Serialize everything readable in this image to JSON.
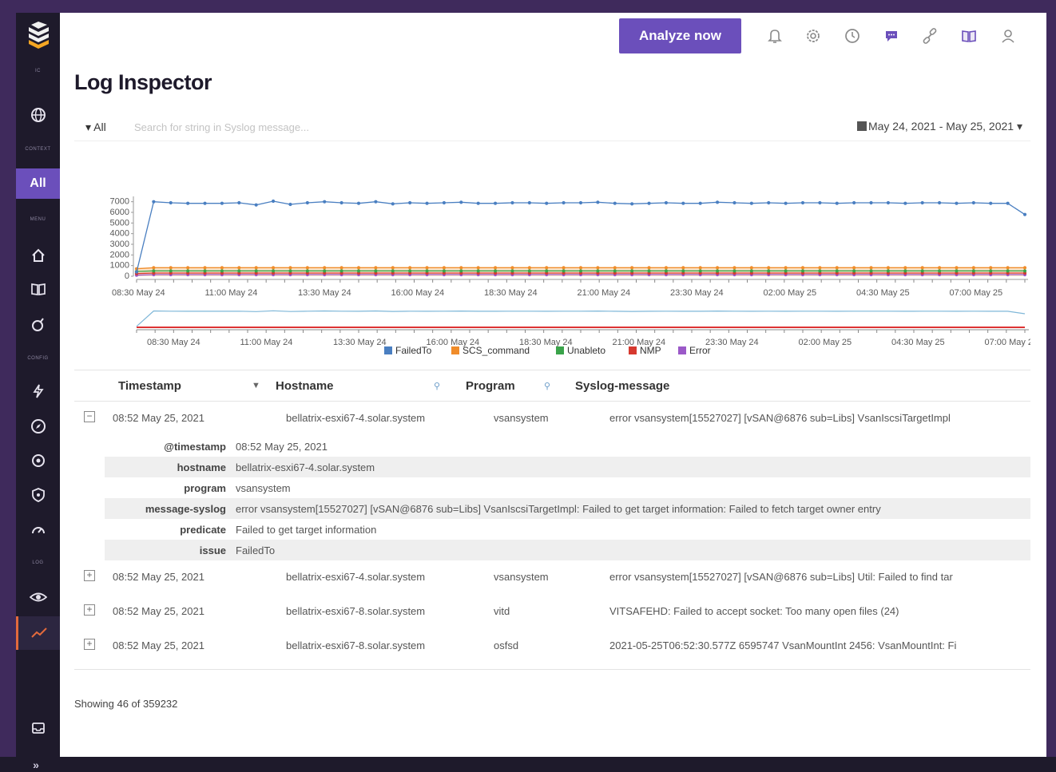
{
  "sidebar": {
    "sections": [
      "IC",
      "CONTEXT",
      "MENU",
      "CONFIG",
      "LOG"
    ],
    "all_label": "All"
  },
  "topbar": {
    "analyze_label": "Analyze now",
    "icons": [
      "bell-icon",
      "settings-icon",
      "help-icon",
      "chat-icon",
      "link-icon",
      "book-icon",
      "user-icon"
    ]
  },
  "page": {
    "title": "Log Inspector"
  },
  "filter": {
    "scope": "All",
    "search_placeholder": "Search for string in Syslog message...",
    "date_range": "May 24, 2021 - May 25, 2021"
  },
  "chart_data": {
    "type": "line",
    "x_ticks": [
      "08:30 May 24",
      "11:00 May 24",
      "13:30 May 24",
      "16:00 May 24",
      "18:30 May 24",
      "21:00 May 24",
      "23:30 May 24",
      "02:00 May 25",
      "04:30 May 25",
      "07:00 May 25"
    ],
    "navigator_ticks": [
      "08:30 May 24",
      "11:00 May 24",
      "13:30 May 24",
      "16:00 May 24",
      "18:30 May 24",
      "21:00 May 24",
      "23:30 May 24",
      "02:00 May 25",
      "04:30 May 25",
      "07:00 May 25"
    ],
    "y_ticks": [
      "0",
      "1000",
      "2000",
      "3000",
      "4000",
      "5000",
      "6000",
      "7000"
    ],
    "ylim": [
      0,
      7500
    ],
    "series": [
      {
        "name": "FailedTo",
        "color": "#4a7fc1",
        "values": [
          400,
          7000,
          6900,
          6850,
          6850,
          6850,
          6900,
          6700,
          7050,
          6750,
          6900,
          7000,
          6900,
          6850,
          7000,
          6800,
          6900,
          6850,
          6900,
          6950,
          6850,
          6850,
          6900,
          6900,
          6850,
          6900,
          6900,
          6950,
          6850,
          6800,
          6850,
          6900,
          6850,
          6850,
          6950,
          6900,
          6850,
          6900,
          6850,
          6900,
          6900,
          6850,
          6900,
          6900,
          6900,
          6850,
          6900,
          6900,
          6850,
          6900,
          6850,
          6850,
          5800
        ]
      },
      {
        "name": "SCS_command",
        "color": "#f08c2a",
        "values": [
          700,
          800,
          800,
          800,
          800,
          800,
          800,
          800,
          800,
          800,
          800,
          800,
          800,
          800,
          800,
          800,
          800,
          800,
          800,
          800,
          800,
          800,
          800,
          800,
          800,
          800,
          800,
          800,
          800,
          800,
          800,
          800,
          800,
          800,
          800,
          800,
          800,
          800,
          800,
          800,
          800,
          800,
          800,
          800,
          800,
          800,
          800,
          800,
          800,
          800,
          800,
          800,
          800
        ]
      },
      {
        "name": "Unableto",
        "color": "#3aa34a",
        "values": [
          450,
          500,
          500,
          500,
          500,
          500,
          500,
          500,
          500,
          500,
          500,
          500,
          500,
          500,
          500,
          500,
          500,
          500,
          500,
          500,
          500,
          500,
          500,
          500,
          500,
          500,
          500,
          500,
          500,
          500,
          500,
          500,
          500,
          500,
          500,
          500,
          500,
          500,
          500,
          500,
          500,
          500,
          500,
          500,
          500,
          500,
          500,
          500,
          500,
          500,
          500,
          500,
          500
        ]
      },
      {
        "name": "NMP",
        "color": "#d6392f",
        "values": [
          250,
          300,
          300,
          300,
          300,
          300,
          300,
          300,
          300,
          300,
          300,
          300,
          300,
          300,
          300,
          300,
          300,
          300,
          300,
          300,
          300,
          300,
          300,
          300,
          300,
          300,
          300,
          300,
          300,
          300,
          300,
          300,
          300,
          300,
          300,
          300,
          300,
          300,
          300,
          300,
          300,
          300,
          300,
          300,
          300,
          300,
          300,
          300,
          300,
          300,
          300,
          300,
          300
        ]
      },
      {
        "name": "Error",
        "color": "#9b59c8",
        "values": [
          100,
          150,
          150,
          150,
          150,
          150,
          150,
          150,
          150,
          150,
          150,
          150,
          150,
          150,
          150,
          150,
          150,
          150,
          150,
          150,
          150,
          150,
          150,
          150,
          150,
          150,
          150,
          150,
          150,
          150,
          150,
          150,
          150,
          150,
          150,
          150,
          150,
          150,
          150,
          150,
          150,
          150,
          150,
          150,
          150,
          150,
          150,
          150,
          150,
          150,
          150,
          150,
          150
        ]
      }
    ],
    "legend": [
      "FailedTo",
      "SCS_command",
      "Unableto",
      "NMP",
      "Error"
    ],
    "legend_position": "bottom-center",
    "grid": false
  },
  "table": {
    "headers": {
      "timestamp": "Timestamp",
      "hostname": "Hostname",
      "program": "Program",
      "message": "Syslog-message"
    },
    "expanded_row": {
      "timestamp": "08:52 May 25, 2021",
      "hostname": "bellatrix-esxi67-4.solar.system",
      "program": "vsansystem",
      "message": "error vsansystem[15527027] [vSAN@6876 sub=Libs] VsanIscsiTargetImpl",
      "details": [
        {
          "key": "@timestamp",
          "value": "08:52 May 25, 2021"
        },
        {
          "key": "hostname",
          "value": "bellatrix-esxi67-4.solar.system"
        },
        {
          "key": "program",
          "value": "vsansystem"
        },
        {
          "key": "message-syslog",
          "value": "error vsansystem[15527027] [vSAN@6876 sub=Libs] VsanIscsiTargetImpl: Failed to get target information: Failed to fetch target owner entry"
        },
        {
          "key": "predicate",
          "value": "Failed to get target information"
        },
        {
          "key": "issue",
          "value": "FailedTo"
        }
      ]
    },
    "rows": [
      {
        "timestamp": "08:52 May 25, 2021",
        "hostname": "bellatrix-esxi67-4.solar.system",
        "program": "vsansystem",
        "message": "error vsansystem[15527027] [vSAN@6876 sub=Libs] Util: Failed to find tar"
      },
      {
        "timestamp": "08:52 May 25, 2021",
        "hostname": "bellatrix-esxi67-8.solar.system",
        "program": "vitd",
        "message": "VITSAFEHD: Failed to accept socket: Too many open files (24)"
      },
      {
        "timestamp": "08:52 May 25, 2021",
        "hostname": "bellatrix-esxi67-8.solar.system",
        "program": "osfsd",
        "message": "2021-05-25T06:52:30.577Z 6595747 VsanMountInt 2456: VsanMountInt: Fi"
      }
    ],
    "footer": "Showing 46 of 359232"
  }
}
